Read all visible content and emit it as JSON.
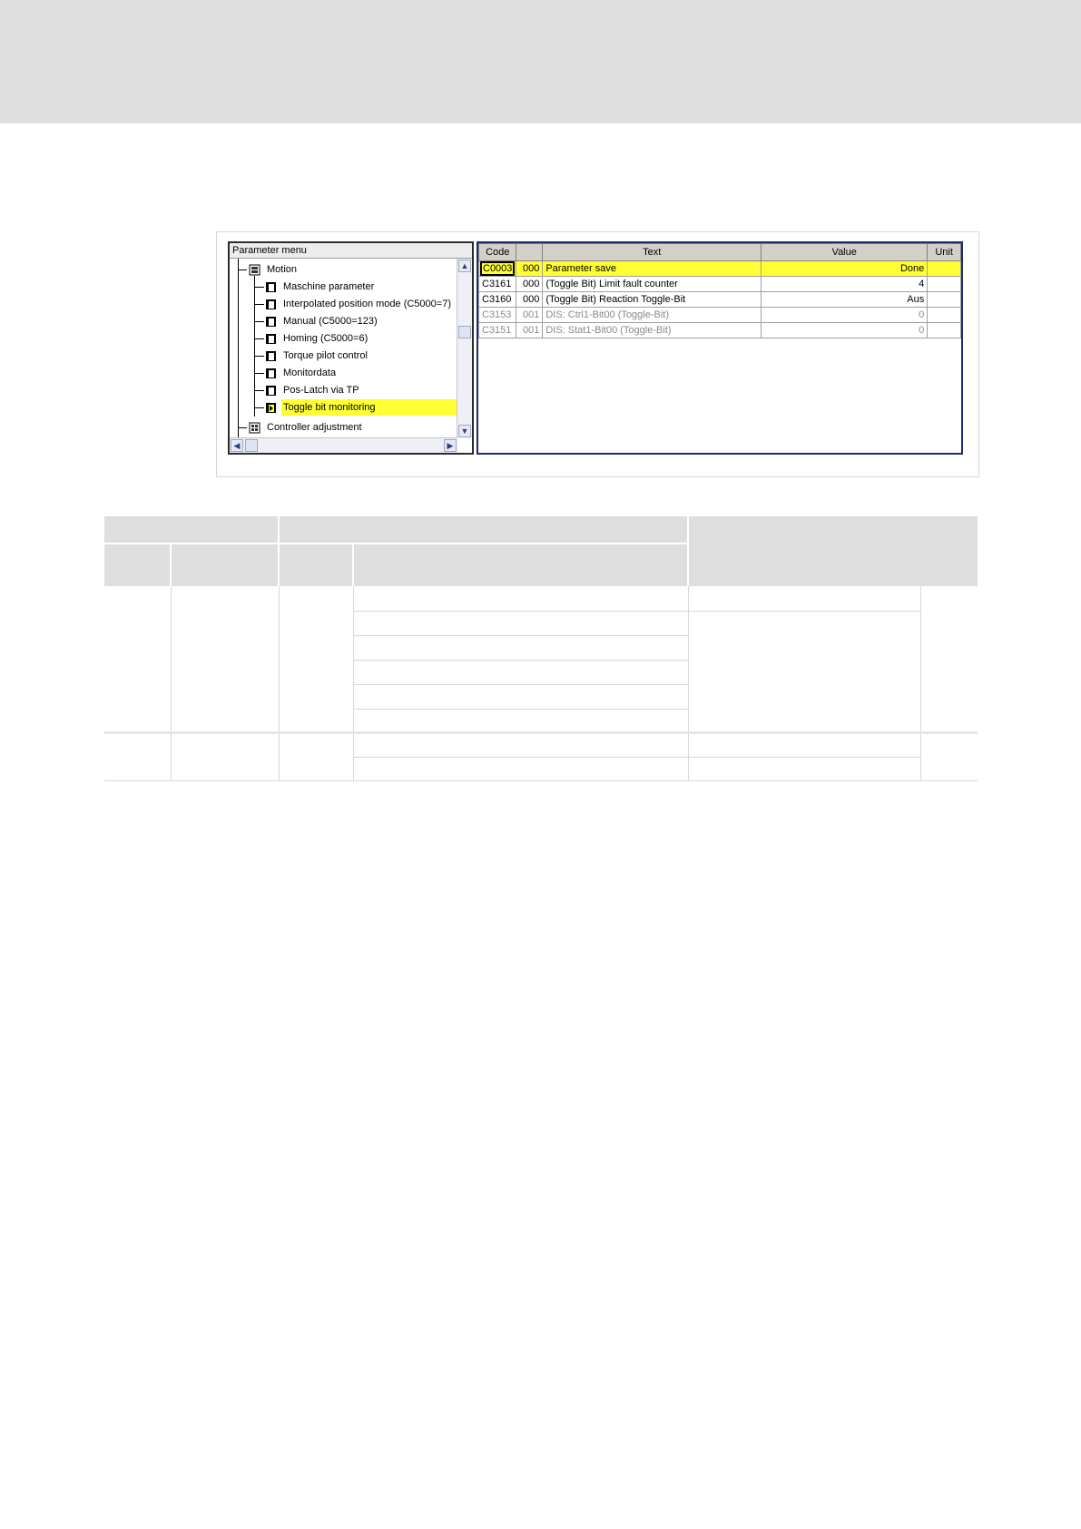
{
  "tree": {
    "header": "Parameter menu",
    "items": [
      {
        "label": "Motion",
        "icon": "folder-open-icon"
      },
      {
        "label": "Maschine parameter",
        "icon": "book-icon"
      },
      {
        "label": "Interpolated position mode (C5000=7)",
        "icon": "book-icon"
      },
      {
        "label": "Manual (C5000=123)",
        "icon": "book-icon"
      },
      {
        "label": "Homing (C5000=6)",
        "icon": "book-icon"
      },
      {
        "label": "Torque pilot control",
        "icon": "book-icon"
      },
      {
        "label": "Monitordata",
        "icon": "book-icon"
      },
      {
        "label": "Pos-Latch via TP",
        "icon": "book-icon"
      },
      {
        "label": "Toggle bit monitoring",
        "icon": "book-icon",
        "selected": true
      },
      {
        "label": "Controller adjustment",
        "icon": "folder-closed-icon"
      }
    ]
  },
  "grid": {
    "columns": [
      "Code",
      "",
      "Text",
      "Value",
      "Unit"
    ],
    "rows": [
      {
        "code": "C0003",
        "sub": "000",
        "text": "Parameter save",
        "value": "Done",
        "unit": "",
        "highlight": true
      },
      {
        "code": "C3161",
        "sub": "000",
        "text": "(Toggle Bit) Limit fault counter",
        "value": "4",
        "unit": ""
      },
      {
        "code": "C3160",
        "sub": "000",
        "text": "(Toggle Bit) Reaction Toggle-Bit",
        "value": "Aus",
        "unit": ""
      },
      {
        "code": "C3153",
        "sub": "001",
        "text": "DIS: Ctrl1-Bit00 (Toggle-Bit)",
        "value": "0",
        "unit": "",
        "dim": true
      },
      {
        "code": "C3151",
        "sub": "001",
        "text": "DIS: Stat1-Bit00 (Toggle-Bit)",
        "value": "0",
        "unit": "",
        "dim": true
      }
    ]
  },
  "colors": {
    "highlight": "#ffff33",
    "grid_border": "#1c2b6b",
    "header_band": "#dedede"
  }
}
